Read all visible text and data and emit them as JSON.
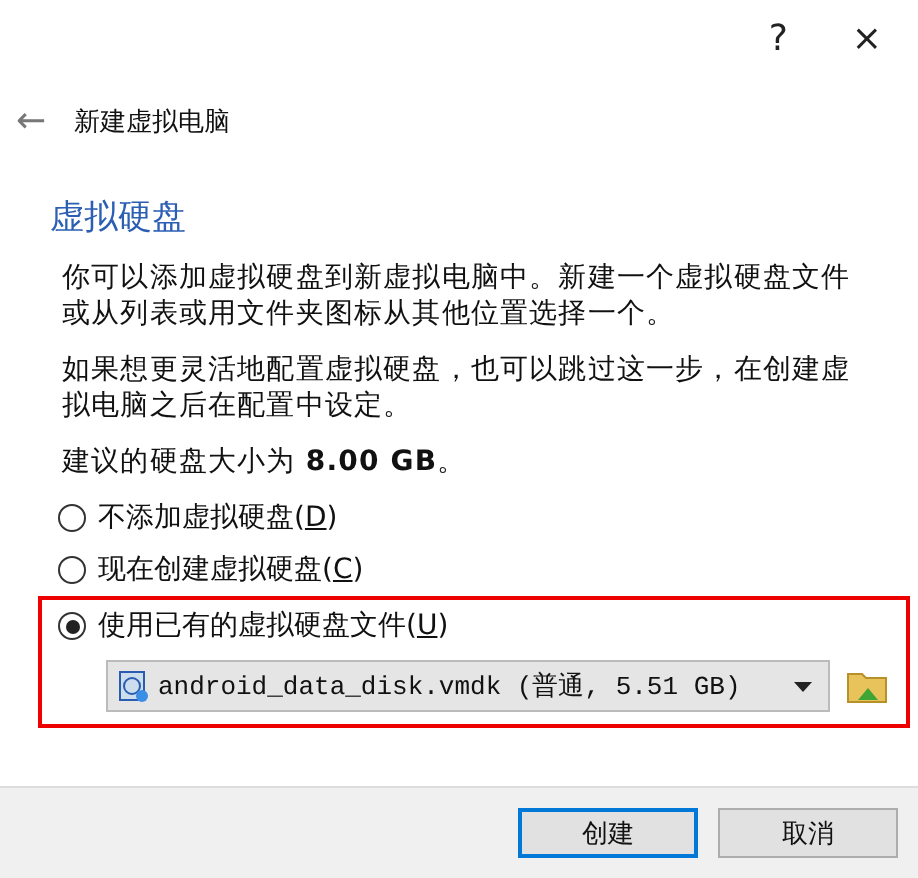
{
  "window": {
    "help": "?",
    "close": "×"
  },
  "header": {
    "back": "←",
    "title": "新建虚拟电脑"
  },
  "heading": "虚拟硬盘",
  "paragraphs": [
    "你可以添加虚拟硬盘到新虚拟电脑中。新建一个虚拟硬盘文件或从列表或用文件夹图标从其他位置选择一个。",
    "如果想更灵活地配置虚拟硬盘，也可以跳过这一步，在创建虚拟电脑之后在配置中设定。",
    "建议的硬盘大小为 **8.00 GB**。"
  ],
  "options": [
    {
      "label_before": "不添加虚拟硬盘(",
      "mnemonic": "D",
      "label_after": ")",
      "selected": false,
      "highlighted": false
    },
    {
      "label_before": "现在创建虚拟硬盘(",
      "mnemonic": "C",
      "label_after": ")",
      "selected": false,
      "highlighted": false
    },
    {
      "label_before": "使用已有的虚拟硬盘文件(",
      "mnemonic": "U",
      "label_after": ")",
      "selected": true,
      "highlighted": true
    }
  ],
  "disk_select": {
    "value": "android_data_disk.vmdk (普通, 5.51 GB)"
  },
  "buttons": [
    {
      "label": "创建",
      "default": true
    },
    {
      "label": "取消",
      "default": false
    }
  ]
}
